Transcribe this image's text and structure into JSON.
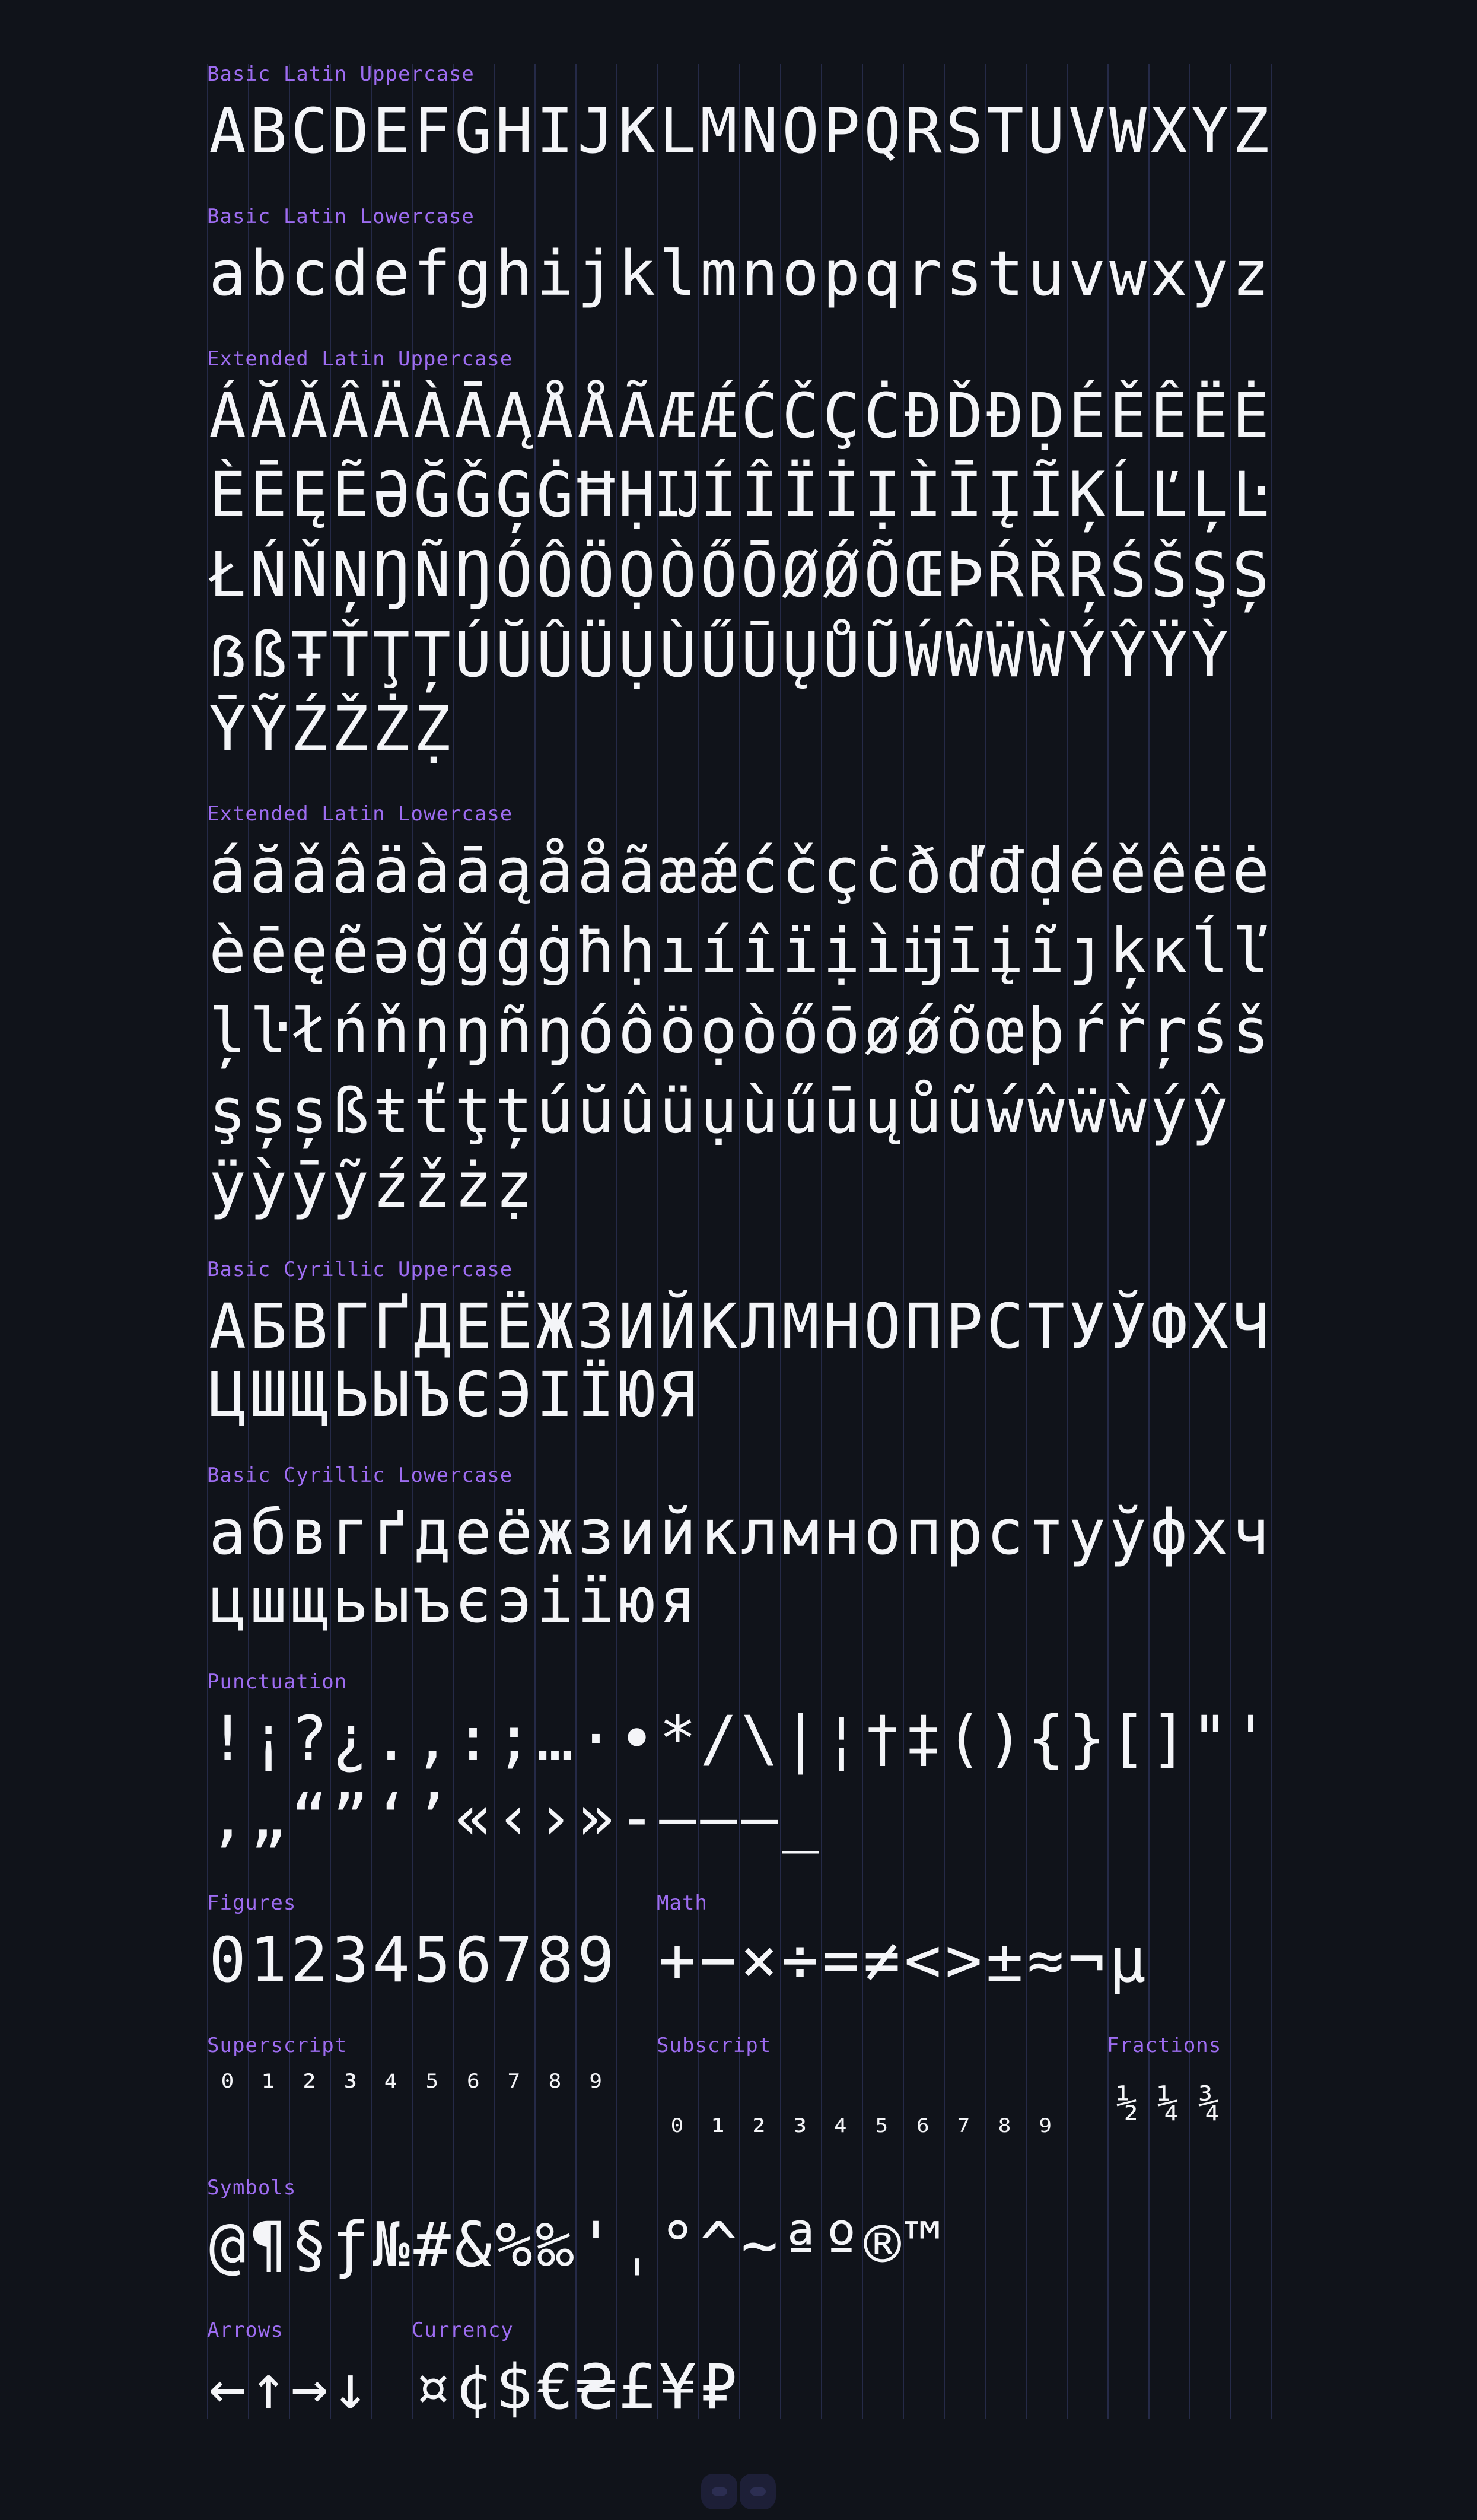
{
  "sections": [
    {
      "id": "basic-latin-uppercase",
      "label": "Basic Latin Uppercase",
      "rows": [
        "ABCDEFGHIJKLMNOPQRSTUVWXYZ"
      ]
    },
    {
      "id": "basic-latin-lowercase",
      "label": "Basic Latin Lowercase",
      "rows": [
        "abcdefghijklmnopqrstuvwxyz"
      ]
    },
    {
      "id": "extended-latin-uppercase",
      "label": "Extended Latin Uppercase",
      "rows": [
        "ÁĂǍÂÄÀĀĄÅǺÃÆǼĆČÇĊĐĎĐḌÉĚÊËĖ",
        "ÈĒĘẼƏĞǦĢĠĦḤĲÍÎÏİỊÌĪĮĨĶĹĽĻĿ",
        "ŁŃŇŅŊÑŊÓÔÖỌÒŐŌØǾÕŒÞŔŘŖŚŠŞȘ",
        "ẞßŦŤŢȚÚŬÛÜỤÙŰŪŲŮŨẂŴẄẀÝŶŸỲ",
        "ȲỸŹŽŻẒ"
      ]
    },
    {
      "id": "extended-latin-lowercase",
      "label": "Extended Latin Lowercase",
      "rows": [
        "áăǎâäàāąåǻãæǽćčçċðďđḍéěêëė",
        "èēęẽəğǧģġħḥıíîïịìĳīįĩȷķĸĺľ",
        "ļŀłńňņŋñŋóôöọòőōøǿõœþŕřŗśš",
        "şșșßŧťţțúŭûüụùűūųůũẃŵẅẁýŷ",
        "ÿỳȳỹźžżẓ"
      ]
    },
    {
      "id": "basic-cyrillic-uppercase",
      "label": "Basic Cyrillic Uppercase",
      "rows": [
        "АБВГҐДЕЁЖЗИЙКЛМНОПРСТУЎФХЧ",
        "ЦШЩЬЫЪЄЭІЇЮЯ"
      ]
    },
    {
      "id": "basic-cyrillic-lowercase",
      "label": "Basic Cyrillic Lowercase",
      "rows": [
        "абвгґдеёжзийклмнопрстуўфхч",
        "цшщьыъєэіїюя"
      ]
    },
    {
      "id": "punctuation",
      "label": "Punctuation",
      "rows": [
        [
          "!",
          "¡",
          "?",
          "¿",
          ".",
          ",",
          ":",
          ";",
          "…",
          "·",
          "•",
          "*",
          "/",
          "\\",
          "|",
          "¦",
          "†",
          "‡",
          "(",
          ")",
          "{",
          "}",
          "[",
          "]",
          "\"",
          "'"
        ],
        [
          ",",
          "„",
          "“",
          "”",
          "‘",
          "’",
          "«",
          "‹",
          "›",
          "»",
          "-",
          "–",
          "—",
          "‒",
          "_"
        ]
      ]
    }
  ],
  "figures": {
    "label": "Figures",
    "glyphs": "0123456789"
  },
  "math": {
    "label": "Math",
    "glyphs": "+−×÷=≠<>±≈¬µ"
  },
  "superscript": {
    "label": "Superscript",
    "glyphs": "⁰¹²³⁴⁵⁶⁷⁸⁹"
  },
  "subscript": {
    "label": "Subscript",
    "glyphs": "₀₁₂₃₄₅₆₇₈₉"
  },
  "fractions": {
    "label": "Fractions",
    "glyphs": "½¼¾"
  },
  "symbols": {
    "label": "Symbols",
    "glyphs": [
      "@",
      "¶",
      "§",
      "ƒ",
      "№",
      "#",
      "&",
      "%",
      "‰",
      "'",
      "ˌ",
      "°",
      "^",
      "~",
      "ª",
      "º",
      "®",
      "™"
    ]
  },
  "arrows": {
    "label": "Arrows",
    "glyphs": "←↑→↓"
  },
  "currency": {
    "label": "Currency",
    "glyphs": "¤¢$€₴£¥₽"
  },
  "colors": {
    "background": "#10131a",
    "label": "#9d6cf0",
    "glyph": "#f4f5f8",
    "grid": "#252a48"
  }
}
